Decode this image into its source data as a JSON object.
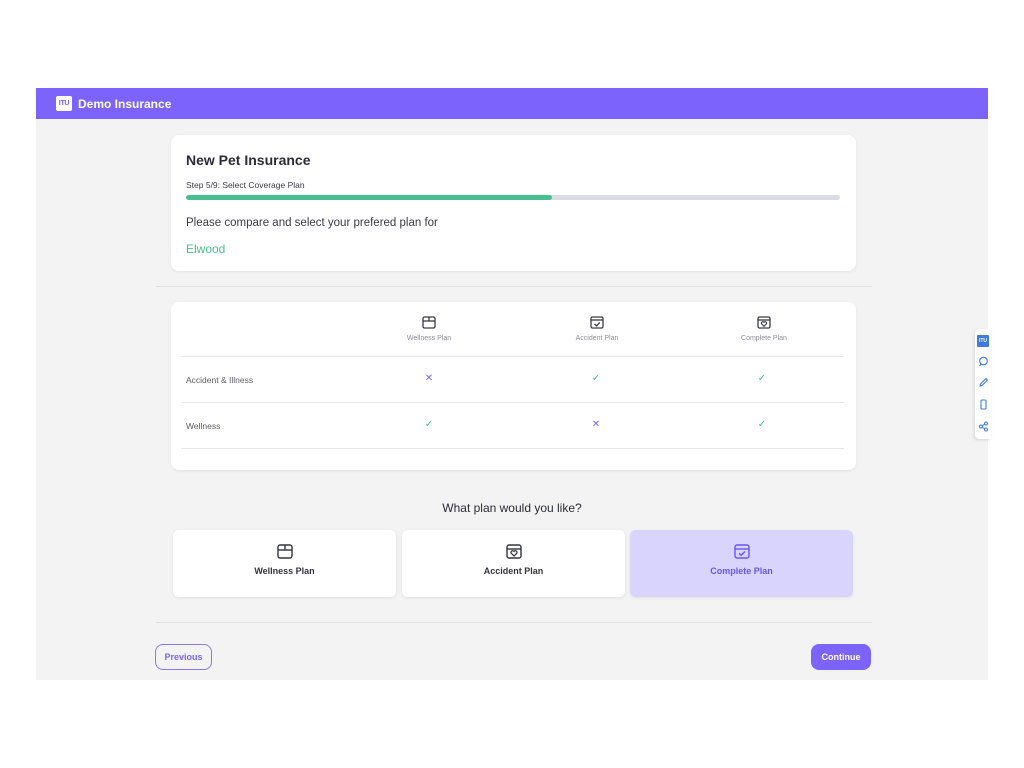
{
  "app": {
    "brand": "Demo Insurance",
    "logo_text": "ITU"
  },
  "header_card": {
    "title": "New Pet Insurance",
    "step": "Step 5/9: Select Coverage Plan",
    "progress_fraction": 0.56,
    "prompt": "Please compare and select your prefered plan for",
    "pet_name": "Elwood"
  },
  "comparison": {
    "columns": [
      {
        "label": "Wellness Plan",
        "icon": "wellness-box-icon"
      },
      {
        "label": "Accident Plan",
        "icon": "accident-box-icon"
      },
      {
        "label": "Complete Plan",
        "icon": "complete-box-icon"
      }
    ],
    "rows": [
      {
        "label": "Accident & Illness",
        "values": [
          "✕",
          "✓",
          "✓"
        ]
      },
      {
        "label": "Wellness",
        "values": [
          "✓",
          "✕",
          "✓"
        ]
      }
    ]
  },
  "question": "What plan would you like?",
  "plans": [
    {
      "label": "Wellness Plan",
      "icon": "wellness-box-icon",
      "selected": false
    },
    {
      "label": "Accident Plan",
      "icon": "accident-box-icon",
      "selected": false
    },
    {
      "label": "Complete Plan",
      "icon": "complete-box-icon",
      "selected": true
    }
  ],
  "nav": {
    "previous_label": "Previous",
    "continue_label": "Continue"
  },
  "sidetools": [
    "logo-icon",
    "chat-icon",
    "pencil-icon",
    "mobile-icon",
    "share-icon"
  ],
  "colors": {
    "brand": "#7b63fb",
    "success": "#48bf8e",
    "selected_plan_bg": "#d9d4fd"
  }
}
